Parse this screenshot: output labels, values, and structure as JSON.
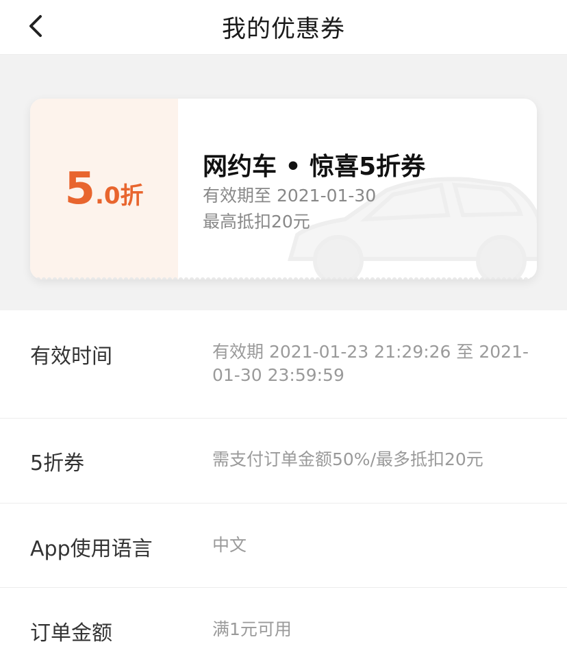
{
  "header": {
    "title": "我的优惠券",
    "back_icon": "chevron-left-icon"
  },
  "coupon": {
    "discount_main": "5",
    "discount_sub": ".0折",
    "title": "网约车 • 惊喜5折券",
    "expire": "有效期至 2021-01-30",
    "max_deduct": "最高抵扣20元",
    "watermark_icon": "car-icon",
    "accent_color": "#e8652e"
  },
  "details": [
    {
      "label": "有效时间",
      "value": "有效期 2021-01-23 21:29:26 至 2021-01-30 23:59:59"
    },
    {
      "label": "5折券",
      "value": "需支付订单金额50%/最多抵扣20元"
    },
    {
      "label": "App使用语言",
      "value": "中文"
    },
    {
      "label": "订单金额",
      "value": "满1元可用"
    }
  ]
}
